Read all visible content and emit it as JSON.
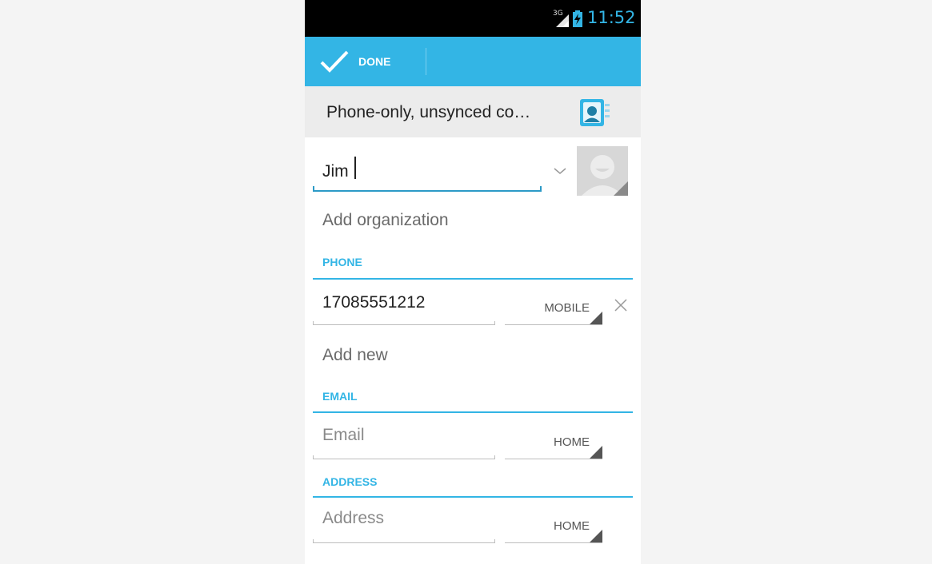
{
  "status_bar": {
    "network": "3G",
    "time": "11:52",
    "icons": [
      "signal-icon",
      "battery-charging-icon"
    ]
  },
  "action_bar": {
    "done_label": "DONE",
    "color": "#33b5e5"
  },
  "account": {
    "label": "Phone-only, unsynced co…",
    "icon": "contacts-icon"
  },
  "name_field": {
    "value": "Jim"
  },
  "organization": {
    "label": "Add organization"
  },
  "phone": {
    "header": "PHONE",
    "value": "17085551212",
    "type": "MOBILE",
    "add_new": "Add new"
  },
  "email": {
    "header": "EMAIL",
    "placeholder": "Email",
    "type": "HOME"
  },
  "address": {
    "header": "ADDRESS",
    "placeholder": "Address",
    "type": "HOME"
  },
  "colors": {
    "accent": "#33b5e5",
    "background": "#f4f4f4"
  }
}
